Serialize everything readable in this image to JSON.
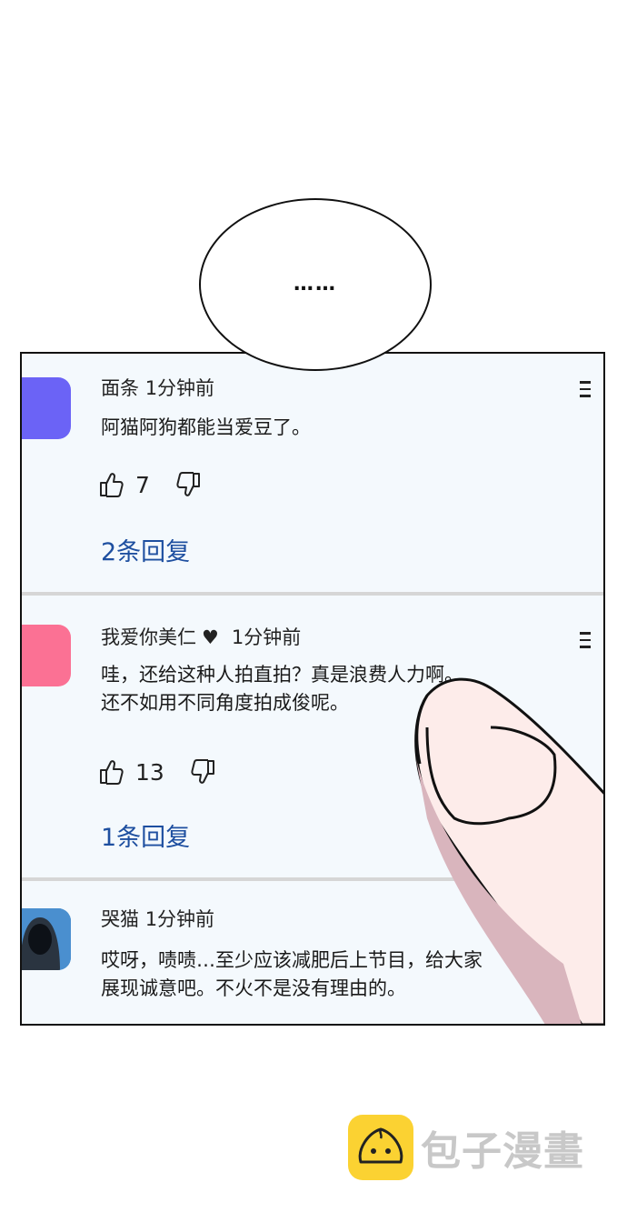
{
  "bubble": {
    "text": "……"
  },
  "comments": [
    {
      "author": "面条",
      "time": "1分钟前",
      "lines": [
        "阿猫阿狗都能当爱豆了。"
      ],
      "likes": "7",
      "replies": "2条回复",
      "avatar_color": "#6b63f6"
    },
    {
      "author": "我爱你美仁",
      "heart": "♥",
      "time": "1分钟前",
      "lines": [
        "哇，还给这种人拍直拍？真是浪费人力啊。",
        "还不如用不同角度拍成俊呢。"
      ],
      "likes": "13",
      "replies": "1条回复",
      "avatar_color": "#fb7194"
    },
    {
      "author": "哭猫",
      "time": "1分钟前",
      "lines": [
        "哎呀，啧啧…至少应该减肥后上节目，给大家",
        "展现诚意吧。不火不是没有理由的。"
      ],
      "avatar_color": "#3d86c8"
    }
  ],
  "watermark": {
    "text": "包子漫畫"
  },
  "colors": {
    "panel_bg": "#f4f9fd",
    "link": "#1e4fa0",
    "finger_fill": "#fdecea",
    "finger_shadow": "#d9b5bd",
    "watermark_logo": "#fbd232"
  }
}
